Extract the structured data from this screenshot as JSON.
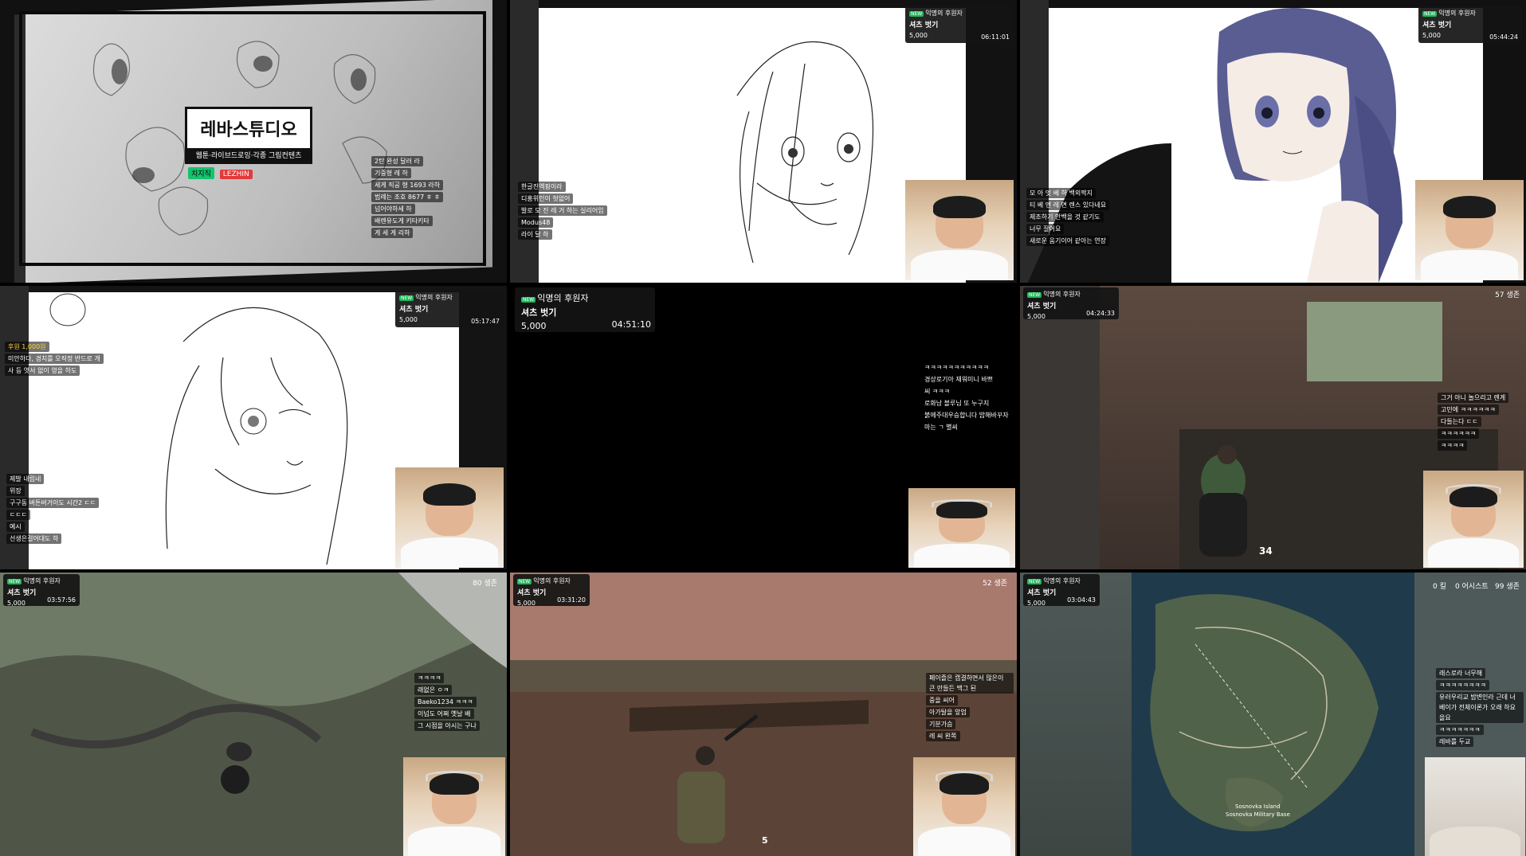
{
  "tiles": [
    {
      "studio_title": "레바스튜디오",
      "studio_subtitle": "웹툰·라이브드로잉·각종 그림컨텐츠",
      "logos": [
        "치지직",
        "LEZHIN"
      ],
      "chat": [
        "2탄 완성 달러 라",
        "기중형 레 하",
        "세게 직공 형 1693 라하",
        "범례는 조호 8677 ㅎ ㅎ",
        "넘어야하세 하",
        "배렌유도게 키타키타",
        "게 세 게 리하"
      ]
    },
    {
      "overlay": {
        "badge": "NEW",
        "title": "익명의 후원자",
        "name": "셔츠 벗기",
        "amount": "5,000",
        "time": "06:11:01"
      },
      "chat": [
        "한글진엑핑이라",
        "디홍위인이 헛없어",
        "발로 모 진 레 거 하는 실리어임",
        "Modus48",
        "라이 달 하"
      ]
    },
    {
      "overlay": {
        "badge": "NEW",
        "title": "익명의 후원자",
        "name": "셔츠 벗기",
        "amount": "5,000",
        "time": "05:44:24"
      },
      "chat": [
        "모 아 엇 베 하 백외짝지",
        "티 베 앤 레 면 렌스 있다네요",
        "제조하기 안백을 것 같기도",
        "너무 잘어요",
        "새로운 움기이어 같아는 연장"
      ]
    },
    {
      "overlay": {
        "badge": "NEW",
        "title": "익명의 후원자",
        "name": "셔츠 벗기",
        "amount": "5,000",
        "time": "05:17:47"
      },
      "notice": [
        "후원 1,000원",
        "미안하다, 경치를 오직정 반드로 개",
        "사 등 엿서 없이 영을 하도"
      ],
      "chat": [
        "제발 내립네",
        "위장",
        "구구동 버튼버거이도 시간2 ㄷㄷ",
        "ㄷㄷㄷ",
        "예시",
        "선생은걸어대도 하"
      ]
    },
    {
      "overlay": {
        "badge": "NEW",
        "title": "익명의 후원자",
        "name": "셔츠 벗기",
        "amount": "5,000",
        "time": "04:51:10"
      },
      "chat": [
        "ㅋㅋㅋㅋㅋㅋㅋㅋㅋㅋㅋ",
        "경상로기아 재워미니 바쁘",
        "씨 ㅋㅋㅋ",
        "로화남 블루님 또 누구지",
        "붉에주대우승합니다 밥해바꾸자",
        "마는 ㄱ 별씨"
      ]
    },
    {
      "overlay": {
        "badge": "NEW",
        "title": "익명의 후원자",
        "name": "셔츠 벗기",
        "amount": "5,000",
        "time": "04:24:33"
      },
      "alive": "57 생존",
      "ammo": "34",
      "chat": [
        "그거 아니 놀으리고 렌게",
        "고민에 ㅋㅋㅋㅋㅋㅋ",
        "다들는다 ㄷㄷ",
        "ㅋㅋㅋㅋㅋㅋ",
        "ㅋㅋㅋㅋ"
      ]
    },
    {
      "overlay": {
        "badge": "NEW",
        "title": "익명의 후원자",
        "name": "셔츠 벗기",
        "amount": "5,000",
        "time": "03:57:56"
      },
      "alive": "80 생존",
      "chat": [
        "ㅋㅋㅋㅋ",
        "래없은 ㅇㅋ",
        "Baeko1234 ㅋㅋㅋ",
        "이넘도 어쩌 옛날 배",
        "그 시점을 아시는 구나"
      ]
    },
    {
      "overlay": {
        "badge": "NEW",
        "title": "익명의 후원자",
        "name": "셔츠 벗기",
        "amount": "5,000",
        "time": "03:31:20"
      },
      "alive": "52 생존",
      "ammo": "5",
      "chat": [
        "페이즐은 캡결하면서 많은이 큰 만들든 맥그 된",
        "중을 씨어",
        "아가탈을 앞엄",
        "기분가슴",
        "레 씨 왼쪽"
      ]
    },
    {
      "overlay": {
        "badge": "NEW",
        "title": "익명의 후원자",
        "name": "셔츠 벗기",
        "amount": "5,000",
        "time": "03:04:43"
      },
      "kills": "0 킬",
      "assists": "0 어시스트",
      "alive": "99 생존",
      "map_labels": [
        "Sosnovka Island",
        "Sosnovka Military Base"
      ],
      "chat": [
        "래스로라 너무해",
        "ㅋㅋㅋㅋㅋㅋㅋㅋ",
        "유러우리교 밤변인라 근데 너 베이가 전체이론가 오래 하요 을요",
        "ㅋㅋㅋㅋㅋㅋㅋ",
        "레바를 두교"
      ]
    }
  ]
}
